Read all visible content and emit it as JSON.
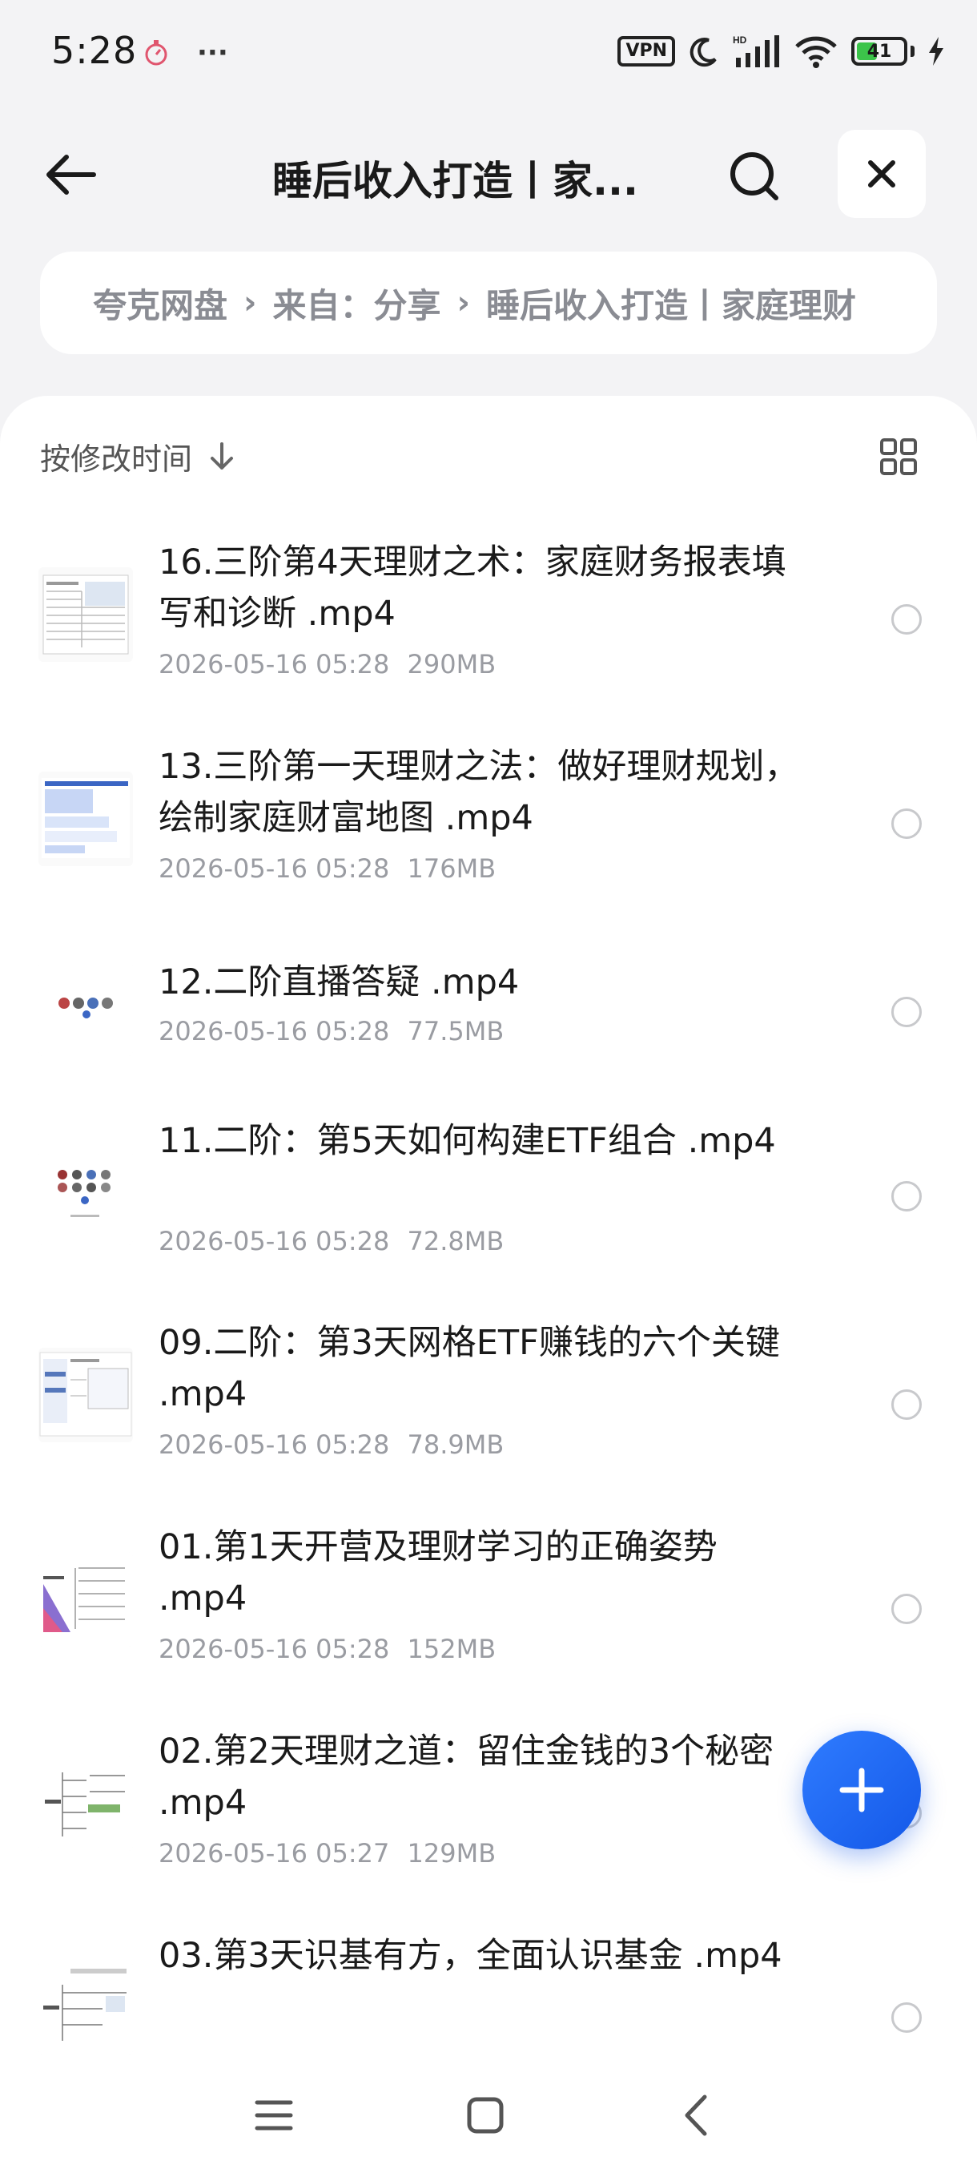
{
  "status_bar": {
    "time": "5:28",
    "more": "···",
    "vpn": "VPN",
    "battery": "41"
  },
  "header": {
    "title": "睡后收入打造丨家..."
  },
  "breadcrumb": {
    "items": [
      "夸克网盘",
      "来自：分享",
      "睡后收入打造丨家庭理财"
    ],
    "separator": "›"
  },
  "list": {
    "sort_label": "按修改时间",
    "files": [
      {
        "name": "16.三阶第4天理财之术：家庭财务报表填写和诊断 .mp4",
        "date": "2026-05-16 05:28",
        "size": "290MB"
      },
      {
        "name": "13.三阶第一天理财之法：做好理财规划，绘制家庭财富地图 .mp4",
        "date": "2026-05-16 05:28",
        "size": "176MB"
      },
      {
        "name": "12.二阶直播答疑 .mp4",
        "date": "2026-05-16 05:28",
        "size": "77.5MB"
      },
      {
        "name": "11.二阶：第5天如何构建ETF组合 .mp4",
        "date": "2026-05-16 05:28",
        "size": "72.8MB"
      },
      {
        "name": "09.二阶：第3天网格ETF赚钱的六个关键 .mp4",
        "date": "2026-05-16 05:28",
        "size": "78.9MB"
      },
      {
        "name": "01.第1天开营及理财学习的正确姿势 .mp4",
        "date": "2026-05-16 05:28",
        "size": "152MB"
      },
      {
        "name": "02.第2天理财之道：留住金钱的3个秘密 .mp4",
        "date": "2026-05-16 05:27",
        "size": "129MB"
      },
      {
        "name": "03.第3天识基有方，全面认识基金 .mp4",
        "date": "",
        "size": ""
      }
    ]
  },
  "colors": {
    "accent": "#1f6bff",
    "background": "#f3f3f5",
    "meta_text": "#9a9ca2"
  },
  "icons": {
    "back": "arrow-left-icon",
    "search": "search-icon",
    "close": "close-icon",
    "sort": "arrow-down-icon",
    "view": "grid-view-icon",
    "fab": "plus-icon",
    "nav": [
      "menu-icon",
      "home-square-icon",
      "back-chevron-icon"
    ]
  }
}
